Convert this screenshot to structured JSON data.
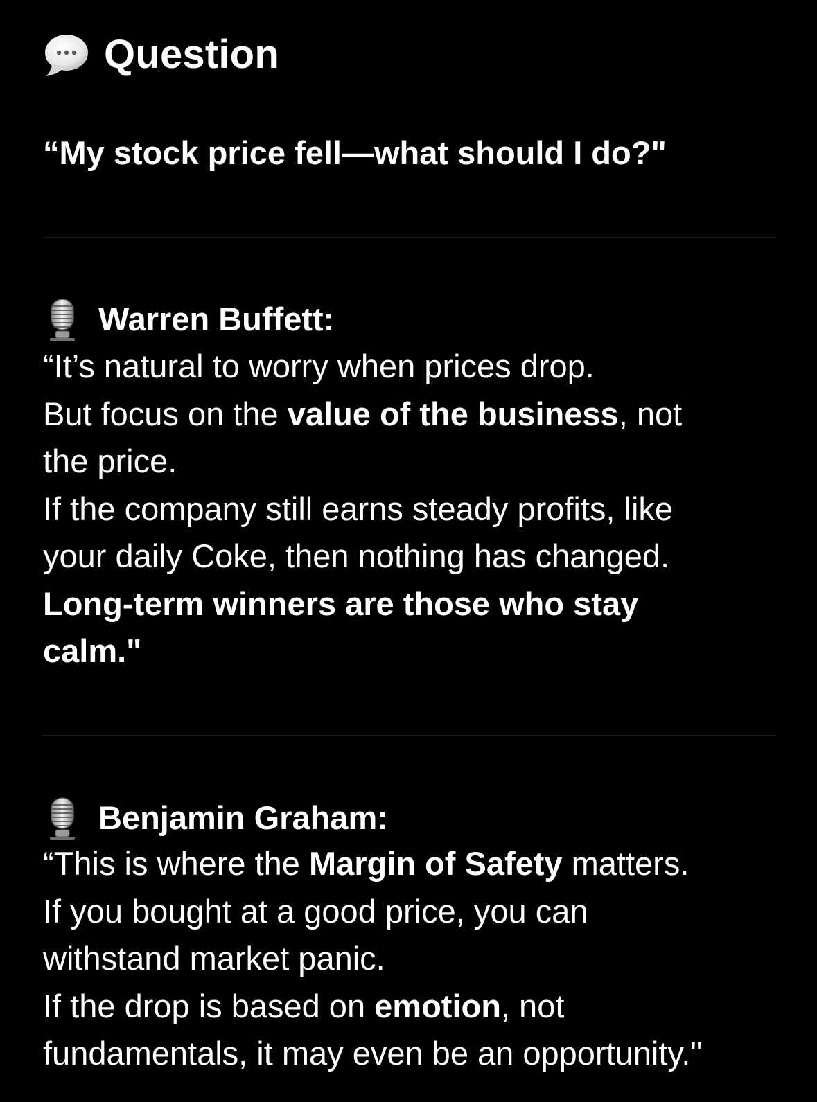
{
  "header": {
    "icon": "speech-bubble-icon",
    "title": "Question"
  },
  "question": {
    "text": "“My stock price fell—what should I do?\""
  },
  "answers": [
    {
      "icon": "microphone-icon",
      "speaker": "Warren Buffett:",
      "lines": [
        {
          "pre": "“It’s natural to worry when prices drop.",
          "bold": "",
          "post": ""
        },
        {
          "pre": "But focus on the ",
          "bold": "value of the business",
          "post": ", not"
        },
        {
          "pre": "the price.",
          "bold": "",
          "post": ""
        },
        {
          "pre": "If the company still earns steady profits, like",
          "bold": "",
          "post": ""
        },
        {
          "pre": "your daily Coke, then nothing has changed.",
          "bold": "",
          "post": ""
        },
        {
          "pre": "",
          "bold": "Long-term winners are those who stay",
          "post": ""
        },
        {
          "pre": "",
          "bold": "calm.\"",
          "post": ""
        }
      ]
    },
    {
      "icon": "microphone-icon",
      "speaker": "Benjamin Graham:",
      "lines": [
        {
          "pre": "“This is where the ",
          "bold": "Margin of Safety",
          "post": " matters."
        },
        {
          "pre": "If you bought at a good price, you can",
          "bold": "",
          "post": ""
        },
        {
          "pre": "withstand market panic.",
          "bold": "",
          "post": ""
        },
        {
          "pre": "If the drop is based on ",
          "bold": "emotion",
          "post": ", not"
        },
        {
          "pre": "fundamentals, it may even be an opportunity.\"",
          "bold": "",
          "post": ""
        }
      ]
    }
  ],
  "colors": {
    "background": "#000000",
    "text": "#ffffff",
    "divider": "#1c1c1e"
  }
}
